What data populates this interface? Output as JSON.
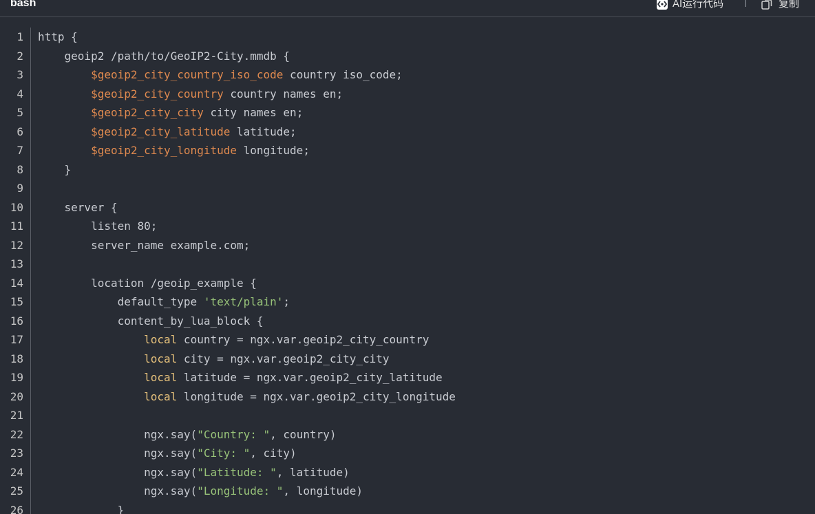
{
  "header": {
    "language": "bash",
    "ai_label": "AI运行代码",
    "copy_label": "复制"
  },
  "icons": {
    "ai": "ai-run-icon",
    "copy": "copy-icon"
  },
  "colors": {
    "background": "#282c34",
    "text": "#c9ccd2",
    "variable": "#e08a4f",
    "keyword": "#e5c07b",
    "string": "#98c379"
  },
  "code": {
    "lines": [
      {
        "n": "1",
        "tokens": [
          {
            "t": "http {",
            "c": ""
          }
        ]
      },
      {
        "n": "2",
        "tokens": [
          {
            "t": "    geoip2 /path/to/GeoIP2-City.mmdb {",
            "c": ""
          }
        ]
      },
      {
        "n": "3",
        "tokens": [
          {
            "t": "        ",
            "c": ""
          },
          {
            "t": "$geoip2_city_country_iso_code",
            "c": "var"
          },
          {
            "t": " country iso_code;",
            "c": ""
          }
        ]
      },
      {
        "n": "4",
        "tokens": [
          {
            "t": "        ",
            "c": ""
          },
          {
            "t": "$geoip2_city_country",
            "c": "var"
          },
          {
            "t": " country names en;",
            "c": ""
          }
        ]
      },
      {
        "n": "5",
        "tokens": [
          {
            "t": "        ",
            "c": ""
          },
          {
            "t": "$geoip2_city_city",
            "c": "var"
          },
          {
            "t": " city names en;",
            "c": ""
          }
        ]
      },
      {
        "n": "6",
        "tokens": [
          {
            "t": "        ",
            "c": ""
          },
          {
            "t": "$geoip2_city_latitude",
            "c": "var"
          },
          {
            "t": " latitude;",
            "c": ""
          }
        ]
      },
      {
        "n": "7",
        "tokens": [
          {
            "t": "        ",
            "c": ""
          },
          {
            "t": "$geoip2_city_longitude",
            "c": "var"
          },
          {
            "t": " longitude;",
            "c": ""
          }
        ]
      },
      {
        "n": "8",
        "tokens": [
          {
            "t": "    }",
            "c": ""
          }
        ]
      },
      {
        "n": "9",
        "tokens": [
          {
            "t": "",
            "c": ""
          }
        ]
      },
      {
        "n": "10",
        "tokens": [
          {
            "t": "    server {",
            "c": ""
          }
        ]
      },
      {
        "n": "11",
        "tokens": [
          {
            "t": "        listen 80;",
            "c": ""
          }
        ]
      },
      {
        "n": "12",
        "tokens": [
          {
            "t": "        server_name example.com;",
            "c": ""
          }
        ]
      },
      {
        "n": "13",
        "tokens": [
          {
            "t": "",
            "c": ""
          }
        ]
      },
      {
        "n": "14",
        "tokens": [
          {
            "t": "        location /geoip_example {",
            "c": ""
          }
        ]
      },
      {
        "n": "15",
        "tokens": [
          {
            "t": "            default_type ",
            "c": ""
          },
          {
            "t": "'text/plain'",
            "c": "str"
          },
          {
            "t": ";",
            "c": ""
          }
        ]
      },
      {
        "n": "16",
        "tokens": [
          {
            "t": "            content_by_lua_block {",
            "c": ""
          }
        ]
      },
      {
        "n": "17",
        "tokens": [
          {
            "t": "                ",
            "c": ""
          },
          {
            "t": "local",
            "c": "kw"
          },
          {
            "t": " country = ngx.var.geoip2_city_country",
            "c": ""
          }
        ]
      },
      {
        "n": "18",
        "tokens": [
          {
            "t": "                ",
            "c": ""
          },
          {
            "t": "local",
            "c": "kw"
          },
          {
            "t": " city = ngx.var.geoip2_city_city",
            "c": ""
          }
        ]
      },
      {
        "n": "19",
        "tokens": [
          {
            "t": "                ",
            "c": ""
          },
          {
            "t": "local",
            "c": "kw"
          },
          {
            "t": " latitude = ngx.var.geoip2_city_latitude",
            "c": ""
          }
        ]
      },
      {
        "n": "20",
        "tokens": [
          {
            "t": "                ",
            "c": ""
          },
          {
            "t": "local",
            "c": "kw"
          },
          {
            "t": " longitude = ngx.var.geoip2_city_longitude",
            "c": ""
          }
        ]
      },
      {
        "n": "21",
        "tokens": [
          {
            "t": "",
            "c": ""
          }
        ]
      },
      {
        "n": "22",
        "tokens": [
          {
            "t": "                ngx.say(",
            "c": ""
          },
          {
            "t": "\"Country: \"",
            "c": "str"
          },
          {
            "t": ", country)",
            "c": ""
          }
        ]
      },
      {
        "n": "23",
        "tokens": [
          {
            "t": "                ngx.say(",
            "c": ""
          },
          {
            "t": "\"City: \"",
            "c": "str"
          },
          {
            "t": ", city)",
            "c": ""
          }
        ]
      },
      {
        "n": "24",
        "tokens": [
          {
            "t": "                ngx.say(",
            "c": ""
          },
          {
            "t": "\"Latitude: \"",
            "c": "str"
          },
          {
            "t": ", latitude)",
            "c": ""
          }
        ]
      },
      {
        "n": "25",
        "tokens": [
          {
            "t": "                ngx.say(",
            "c": ""
          },
          {
            "t": "\"Longitude: \"",
            "c": "str"
          },
          {
            "t": ", longitude)",
            "c": ""
          }
        ]
      },
      {
        "n": "26",
        "tokens": [
          {
            "t": "            }",
            "c": ""
          }
        ]
      }
    ]
  }
}
